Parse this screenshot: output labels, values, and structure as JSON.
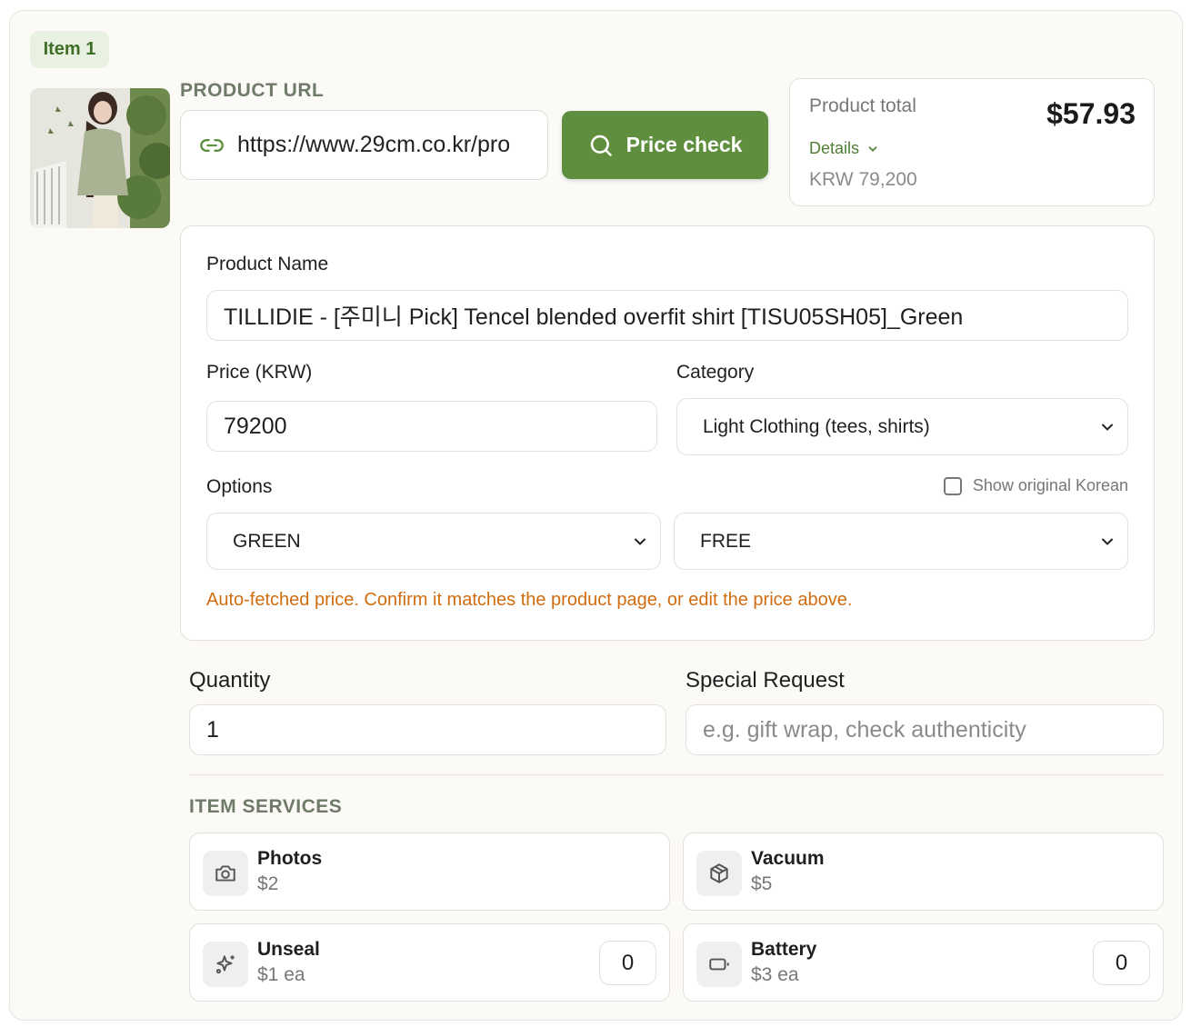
{
  "item": {
    "badge": "Item 1",
    "product_url_label": "PRODUCT URL",
    "product_url_value": "https://www.29cm.co.kr/pro",
    "price_check_label": "Price check"
  },
  "total": {
    "label": "Product total",
    "amount": "$57.93",
    "details_label": "Details",
    "krw": "KRW 79,200"
  },
  "form": {
    "product_name_label": "Product Name",
    "product_name_value": "TILLIDIE - [주미니 Pick] Tencel blended overfit shirt [TISU05SH05]_Green",
    "price_label": "Price (KRW)",
    "price_value": "79200",
    "category_label": "Category",
    "category_value": "Light Clothing (tees, shirts)",
    "options_label": "Options",
    "show_korean_label": "Show original Korean",
    "option1_value": "GREEN",
    "option2_value": "FREE",
    "note": "Auto-fetched price. Confirm it matches the product page, or edit the price above."
  },
  "extra": {
    "quantity_label": "Quantity",
    "quantity_value": "1",
    "special_label": "Special Request",
    "special_placeholder": "e.g. gift wrap, check authenticity"
  },
  "services": {
    "title": "ITEM SERVICES",
    "items": [
      {
        "name": "Photos",
        "price": "$2",
        "icon": "camera-icon"
      },
      {
        "name": "Vacuum",
        "price": "$5",
        "icon": "box-icon"
      },
      {
        "name": "Unseal",
        "price": "$1 ea",
        "icon": "sparkle-icon",
        "qty": "0"
      },
      {
        "name": "Battery",
        "price": "$3 ea",
        "icon": "battery-icon",
        "qty": "0"
      }
    ]
  },
  "colors": {
    "accent": "#5e8e3e",
    "warning": "#d06d10",
    "badge_bg": "#e8f1e2"
  }
}
